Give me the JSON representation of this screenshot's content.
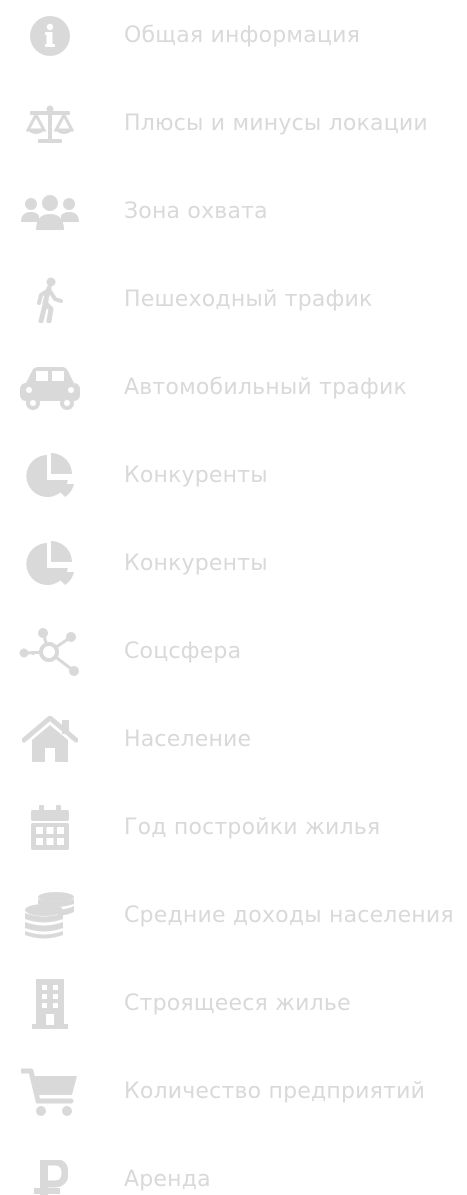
{
  "colors": {
    "icon": "#d9d9d9",
    "label": "#d9d9d9",
    "background": "#ffffff"
  },
  "nav": {
    "items": [
      {
        "label": "Общая информация",
        "icon": "info-icon"
      },
      {
        "label": "Плюсы и минусы локации",
        "icon": "scales-icon"
      },
      {
        "label": "Зона охвата",
        "icon": "users-icon"
      },
      {
        "label": "Пешеходный трафик",
        "icon": "walking-icon"
      },
      {
        "label": "Автомобильный трафик",
        "icon": "car-icon"
      },
      {
        "label": "Конкуренты",
        "icon": "pie-chart-icon"
      },
      {
        "label": "Конкуренты",
        "icon": "pie-chart-icon"
      },
      {
        "label": "Соцсфера",
        "icon": "network-icon"
      },
      {
        "label": "Население",
        "icon": "home-icon"
      },
      {
        "label": "Год постройки жилья",
        "icon": "calendar-icon"
      },
      {
        "label": "Средние доходы населения",
        "icon": "coins-icon"
      },
      {
        "label": "Строящееся жилье",
        "icon": "building-icon"
      },
      {
        "label": "Количество предприятий",
        "icon": "cart-icon"
      },
      {
        "label": "Аренда",
        "icon": "ruble-icon"
      }
    ]
  }
}
